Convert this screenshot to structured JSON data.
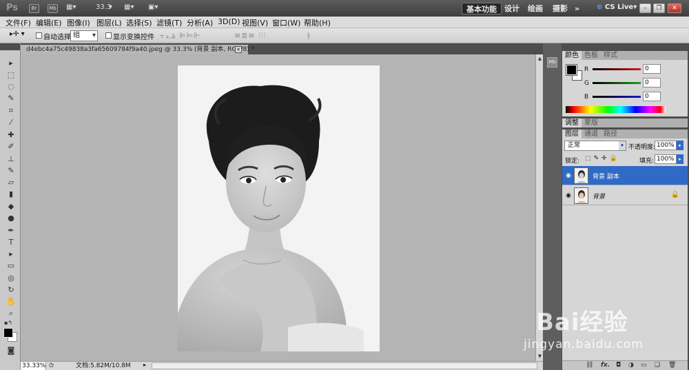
{
  "titlebar": {
    "app_logo": "Ps",
    "btn_br": "Br",
    "btn_mb": "Mb",
    "zoom": "33.3",
    "workspaces": [
      "基本功能",
      "设计",
      "绘画",
      "摄影"
    ],
    "more": "»",
    "cslive": "CS Live",
    "window_controls": [
      "minimize-icon",
      "restore-icon",
      "close-icon"
    ]
  },
  "menu": [
    "文件(F)",
    "编辑(E)",
    "图像(I)",
    "图层(L)",
    "选择(S)",
    "滤镜(T)",
    "分析(A)",
    "3D(D)",
    "视图(V)",
    "窗口(W)",
    "帮助(H)"
  ],
  "options": {
    "auto_select_label": "自动选择:",
    "auto_select_value": "组",
    "show_transform_label": "显示变换控件"
  },
  "document": {
    "tab_title": "d4ebc4a75c49838a3fa65609784f9a40.jpeg @ 33.3% (背景 副本, RGB/8) *",
    "tab_close": "×"
  },
  "status": {
    "zoom": "33.33%",
    "doc_info": "文档:5.82M/10.8M"
  },
  "color_panel": {
    "tabs": [
      "颜色",
      "色板",
      "样式"
    ],
    "channels": [
      {
        "label": "R",
        "value": "0",
        "color": "#d11a1a"
      },
      {
        "label": "G",
        "value": "0",
        "color": "#18a318"
      },
      {
        "label": "B",
        "value": "0",
        "color": "#1818c8"
      }
    ]
  },
  "adjust_tabs": [
    "调整",
    "蒙版"
  ],
  "layers_panel": {
    "tabs": [
      "图层",
      "通道",
      "路径"
    ],
    "blend_mode": "正常",
    "opacity_label": "不透明度:",
    "opacity": "100%",
    "lock_label": "锁定:",
    "fill_label": "填充:",
    "fill": "100%",
    "layers": [
      {
        "name": "背景 副本",
        "selected": true
      },
      {
        "name": "背景",
        "selected": false
      }
    ],
    "footer_icons": [
      "link-icon",
      "fx-icon",
      "mask-icon",
      "adjustment-icon",
      "folder-icon",
      "new-layer-icon",
      "trash-icon"
    ]
  },
  "watermark": {
    "brand": "Bai经验",
    "url": "jingyan.baidu.com"
  },
  "colors": {
    "accent": "#316ac5",
    "dark_chrome": "#4d4d4d",
    "canvas": "#b4b4b4"
  }
}
